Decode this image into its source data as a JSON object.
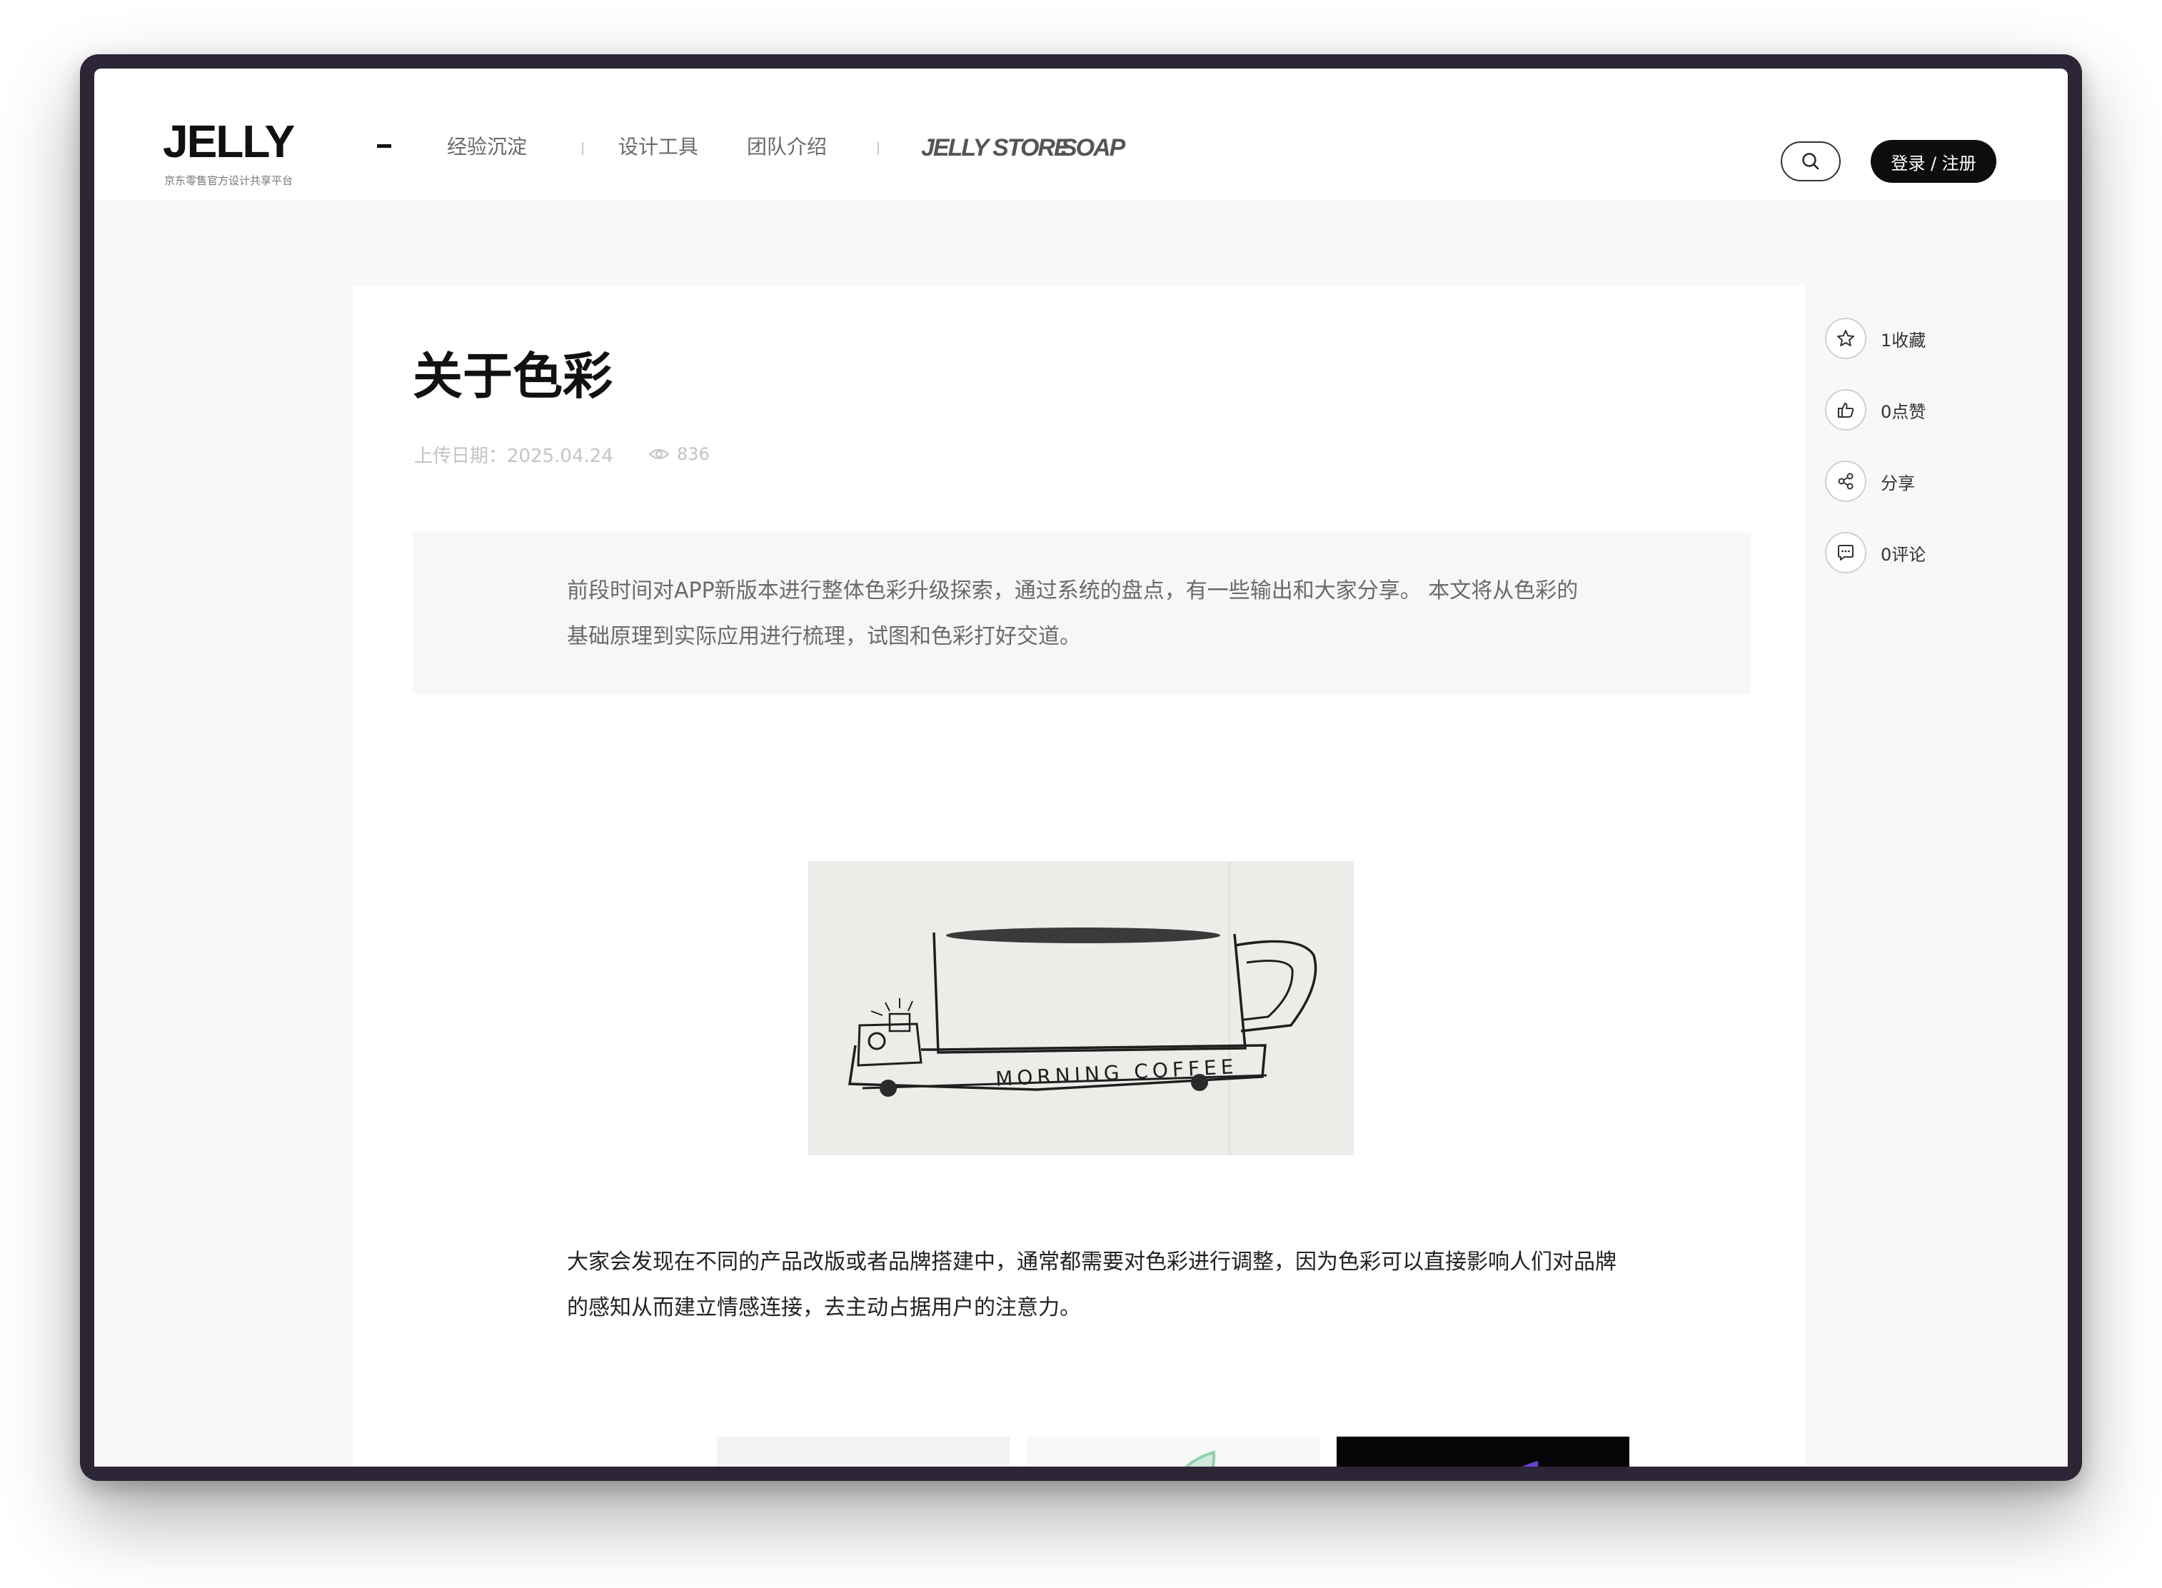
{
  "header": {
    "logo": "JELLY",
    "logo_subtitle": "京东零售官方设计共享平台",
    "nav": [
      {
        "label": "经验沉淀"
      },
      {
        "label": "设计工具"
      },
      {
        "label": "团队介绍"
      }
    ],
    "brands": [
      {
        "label": "JELLY STORE"
      },
      {
        "label": "SOAP"
      }
    ],
    "search_icon": "search-icon",
    "login_label": "登录 / 注册"
  },
  "article": {
    "title": "关于色彩",
    "upload_date": "上传日期：2025.04.24",
    "views": "836",
    "intro": "前段时间对APP新版本进行整体色彩升级探索，通过系统的盘点，有一些输出和大家分享。 本文将从色彩的基础原理到实际应用进行梳理，试图和色彩打好交道。",
    "illustration_text": "MORNING COFFEE",
    "paragraph": "大家会发现在不同的产品改版或者品牌搭建中，通常都需要对色彩进行调整，因为色彩可以直接影响人们对品牌的感知从而建立情感连接，去主动占据用户的注意力。"
  },
  "actions": [
    {
      "icon": "star-icon",
      "label": "1收藏"
    },
    {
      "icon": "thumbs-up-icon",
      "label": "0点赞"
    },
    {
      "icon": "share-icon",
      "label": "分享"
    },
    {
      "icon": "comment-icon",
      "label": "0评论"
    }
  ],
  "colors": {
    "frame": "#2c2535",
    "page_bg": "#f8f8f8",
    "primary_button": "#0d0d0d",
    "meta_text": "#c4c4c4"
  }
}
